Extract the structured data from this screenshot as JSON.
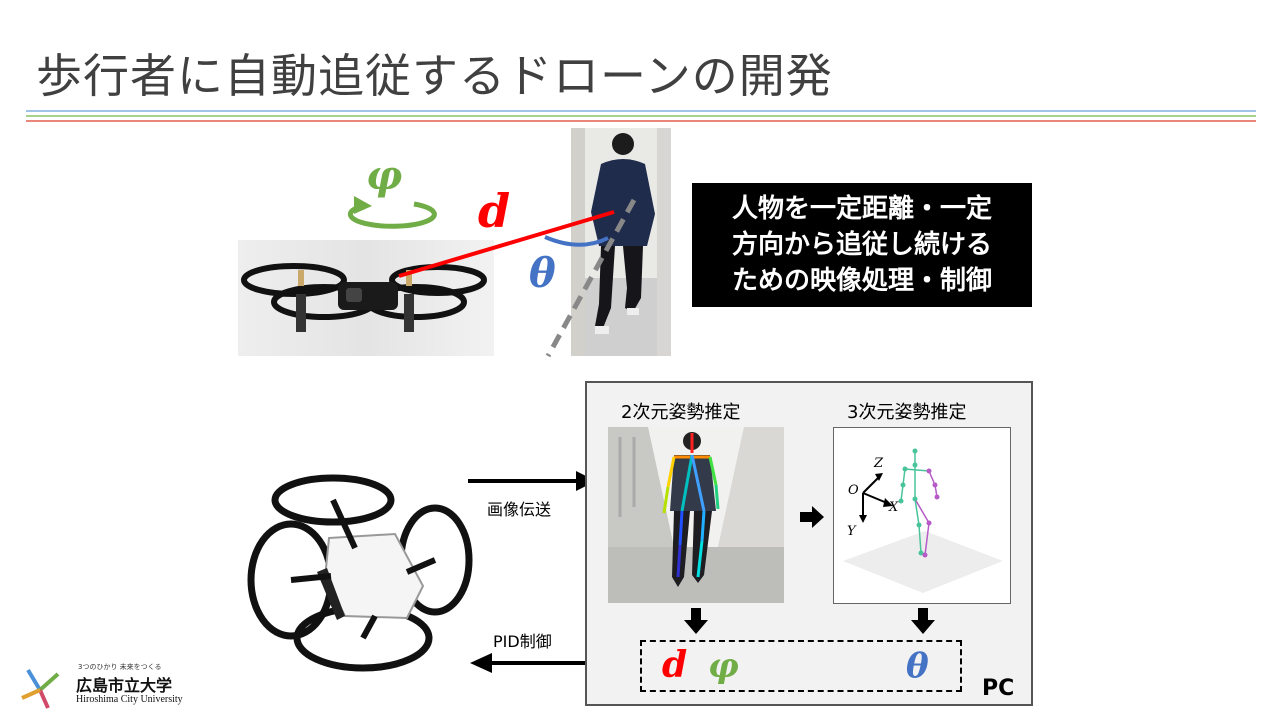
{
  "slide": {
    "title": "歩行者に自動追従するドローンの開発"
  },
  "note": {
    "lines": [
      "人物を一定距離・一定",
      "方向から追従し続ける",
      "ための映像処理・制御"
    ]
  },
  "symbols": {
    "d": "d",
    "phi": "φ",
    "theta": "θ"
  },
  "pc_panel": {
    "title_2d": "2次元姿勢推定",
    "title_3d": "3次元姿勢推定",
    "label": "PC",
    "axes": {
      "z": "Z",
      "o": "O",
      "x": "X",
      "y": "Y"
    }
  },
  "flow": {
    "image_transfer": "画像伝送",
    "pid_control": "PID制御"
  },
  "logo": {
    "tagline": "3つのひかり 未来をつくる",
    "name_ja": "広島市立大学",
    "name_en": "Hiroshima City University"
  },
  "colors": {
    "d": "#ff0000",
    "phi": "#70ad47",
    "theta": "#4472c4",
    "title": "#404040"
  }
}
